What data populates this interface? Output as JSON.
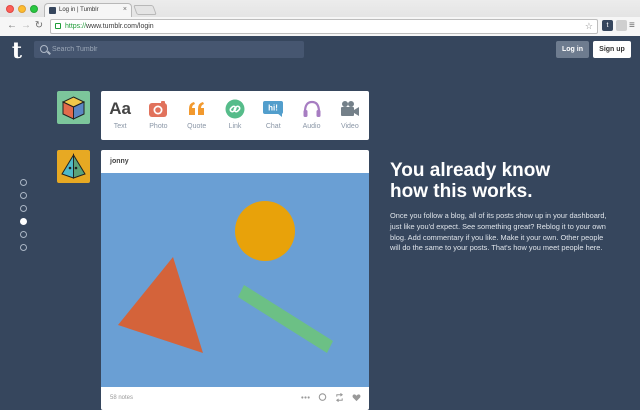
{
  "browser": {
    "tab_title": "Log in | Tumblr",
    "tab_close": "×",
    "url_scheme": "https://",
    "url_rest": "www.tumblr.com/login",
    "ext_label": "t"
  },
  "header": {
    "logo": "t",
    "search_placeholder": "Search Tumblr",
    "login_label": "Log in",
    "signup_label": "Sign up"
  },
  "post_types": [
    {
      "id": "text",
      "label": "Text",
      "glyph": "Aa",
      "color": "#444444"
    },
    {
      "id": "photo",
      "label": "Photo",
      "color": "#e1725c"
    },
    {
      "id": "quote",
      "label": "Quote",
      "glyph": "“",
      "color": "#f2992e"
    },
    {
      "id": "link",
      "label": "Link",
      "color": "#56bc8a"
    },
    {
      "id": "chat",
      "label": "Chat",
      "glyph": "hi!",
      "color": "#529ecc"
    },
    {
      "id": "audio",
      "label": "Audio",
      "color": "#a77dc2"
    },
    {
      "id": "video",
      "label": "Video",
      "color": "#748089"
    }
  ],
  "post": {
    "author": "jonny",
    "notes": "58 notes",
    "image_bg": "#6a9fd4",
    "shapes": {
      "circle": "#e8a20a",
      "triangle": "#d4633a",
      "bar": "#6cc085"
    }
  },
  "pagination": {
    "count": 6,
    "active_index": 3
  },
  "hero": {
    "title": "You already know how this works.",
    "body": "Once you follow a blog, all of its posts show up in your dashboard, just like you'd expect. See something great? Reblog it to your own blog. Add commentary if you like. Make it your own. Other people will do the same to your posts. That's how you meet people here."
  },
  "colors": {
    "background": "#36465d",
    "search_bg": "#465670",
    "login_bg": "#6e7c8f"
  }
}
